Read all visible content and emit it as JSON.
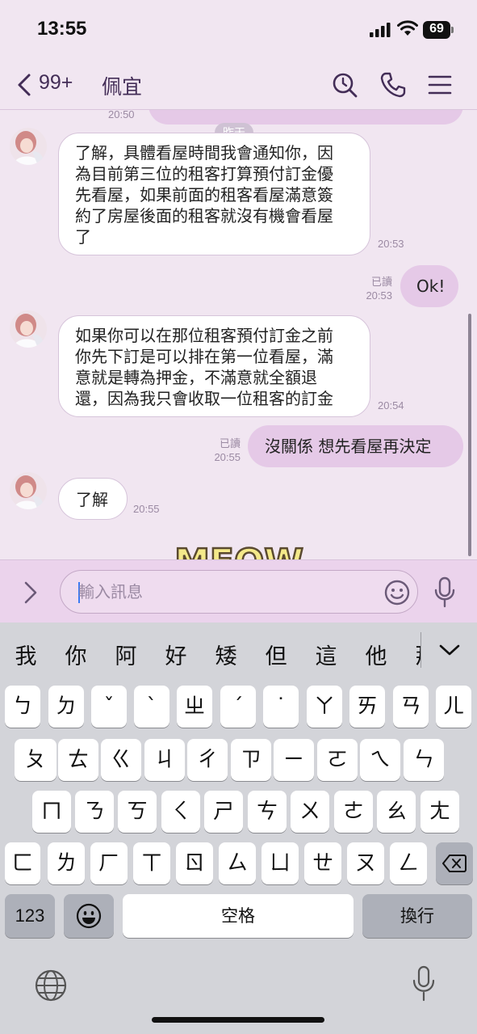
{
  "status_bar": {
    "time": "13:55",
    "battery": "69"
  },
  "nav": {
    "back_count": "99+",
    "title": "佩宜"
  },
  "chat": {
    "date_badge": "昨天",
    "prev_time": "20:50",
    "messages": [
      {
        "from": "other",
        "lines": [
          "了解，具體看屋時間我會通知你，因",
          "為目前第三位的租客打算預付訂金優",
          "先看屋，如果前面的租客看屋滿意簽",
          "約了房屋後面的租客就沒有機會看屋",
          "了"
        ],
        "time": "20:53"
      },
      {
        "from": "me",
        "text": "Ok!",
        "read": "已讀",
        "time": "20:53"
      },
      {
        "from": "other",
        "lines": [
          "如果你可以在那位租客預付訂金之前",
          "你先下訂是可以排在第一位看屋，滿",
          "意就是轉為押金，不滿意就全額退",
          "還，因為我只會收取一位租客的訂金"
        ],
        "time": "20:54"
      },
      {
        "from": "me",
        "text": "沒關係 想先看屋再決定",
        "read": "已讀",
        "time": "20:55"
      },
      {
        "from": "other",
        "text": "了解",
        "time": "20:55"
      }
    ],
    "sticker_text": "MEOW"
  },
  "input": {
    "placeholder": "輸入訊息"
  },
  "keyboard": {
    "candidates": [
      "我",
      "你",
      "阿",
      "好",
      "矮",
      "但",
      "這",
      "他",
      "那"
    ],
    "row1": [
      "ㄅ",
      "ㄉ",
      "ˇ",
      "ˋ",
      "ㄓ",
      "ˊ",
      "˙",
      "ㄚ",
      "ㄞ",
      "ㄢ",
      "ㄦ"
    ],
    "row2": [
      "ㄆ",
      "ㄊ",
      "ㄍ",
      "ㄐ",
      "ㄔ",
      "ㄗ",
      "ㄧ",
      "ㄛ",
      "ㄟ",
      "ㄣ"
    ],
    "row3": [
      "ㄇ",
      "ㄋ",
      "ㄎ",
      "ㄑ",
      "ㄕ",
      "ㄘ",
      "ㄨ",
      "ㄜ",
      "ㄠ",
      "ㄤ"
    ],
    "row4": [
      "ㄈ",
      "ㄌ",
      "ㄏ",
      "ㄒ",
      "ㄖ",
      "ㄙ",
      "ㄩ",
      "ㄝ",
      "ㄡ",
      "ㄥ"
    ],
    "numbers_key": "123",
    "space_key": "空格",
    "return_key": "換行"
  },
  "icons": {
    "back": "chevron-left-icon",
    "search": "search-icon",
    "call": "phone-icon",
    "menu": "menu-icon",
    "expand": "chevron-right-icon",
    "emoji": "emoji-icon",
    "mic": "microphone-icon",
    "globe": "globe-icon",
    "delete": "backspace-icon"
  },
  "colors": {
    "background": "#f1e6f1",
    "my_bubble": "#e5c9e7",
    "accent": "#432d57"
  }
}
